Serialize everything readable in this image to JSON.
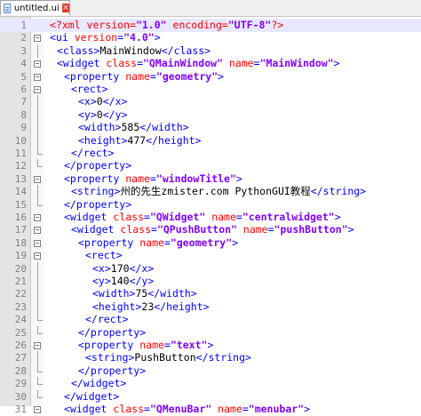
{
  "tab": {
    "label": "untitled.ui",
    "close": "×"
  },
  "colors": {
    "tag": "#0000ff",
    "attr": "#ff0000",
    "value": "#8000ff",
    "text": "#000000",
    "gutter": "#e4e4e4",
    "current_line": "#e8e8ff"
  },
  "lines": [
    {
      "n": "1",
      "indent": 0,
      "fold": "",
      "parts": [
        [
          "pi",
          "<?xml "
        ],
        [
          "attr",
          "version"
        ],
        [
          "pi",
          "="
        ],
        [
          "val",
          "\"1.0\""
        ],
        [
          "pi",
          " "
        ],
        [
          "attr",
          "encoding"
        ],
        [
          "pi",
          "="
        ],
        [
          "val",
          "\"UTF-8\""
        ],
        [
          "pi",
          "?>"
        ]
      ]
    },
    {
      "n": "2",
      "indent": 0,
      "fold": "minus",
      "parts": [
        [
          "tag",
          "<ui "
        ],
        [
          "attr",
          "version"
        ],
        [
          "tag",
          "="
        ],
        [
          "val",
          "\"4.0\""
        ],
        [
          "tag",
          ">"
        ]
      ]
    },
    {
      "n": "3",
      "indent": 1,
      "fold": "",
      "parts": [
        [
          "tag",
          "<class>"
        ],
        [
          "txt",
          "MainWindow"
        ],
        [
          "tag",
          "</class>"
        ]
      ]
    },
    {
      "n": "4",
      "indent": 1,
      "fold": "minus",
      "parts": [
        [
          "tag",
          "<widget "
        ],
        [
          "attr",
          "class"
        ],
        [
          "tag",
          "="
        ],
        [
          "val",
          "\"QMainWindow\""
        ],
        [
          "tag",
          " "
        ],
        [
          "attr",
          "name"
        ],
        [
          "tag",
          "="
        ],
        [
          "val",
          "\"MainWindow\""
        ],
        [
          "tag",
          ">"
        ]
      ]
    },
    {
      "n": "5",
      "indent": 2,
      "fold": "minus",
      "parts": [
        [
          "tag",
          "<property "
        ],
        [
          "attr",
          "name"
        ],
        [
          "tag",
          "="
        ],
        [
          "val",
          "\"geometry\""
        ],
        [
          "tag",
          ">"
        ]
      ]
    },
    {
      "n": "6",
      "indent": 3,
      "fold": "minus",
      "parts": [
        [
          "tag",
          "<rect>"
        ]
      ]
    },
    {
      "n": "7",
      "indent": 4,
      "fold": "",
      "parts": [
        [
          "tag",
          "<x>"
        ],
        [
          "txt",
          "0"
        ],
        [
          "tag",
          "</x>"
        ]
      ]
    },
    {
      "n": "8",
      "indent": 4,
      "fold": "",
      "parts": [
        [
          "tag",
          "<y>"
        ],
        [
          "txt",
          "0"
        ],
        [
          "tag",
          "</y>"
        ]
      ]
    },
    {
      "n": "9",
      "indent": 4,
      "fold": "",
      "parts": [
        [
          "tag",
          "<width>"
        ],
        [
          "txt",
          "585"
        ],
        [
          "tag",
          "</width>"
        ]
      ]
    },
    {
      "n": "10",
      "indent": 4,
      "fold": "",
      "parts": [
        [
          "tag",
          "<height>"
        ],
        [
          "txt",
          "477"
        ],
        [
          "tag",
          "</height>"
        ]
      ]
    },
    {
      "n": "11",
      "indent": 3,
      "fold": "end",
      "parts": [
        [
          "tag",
          "</rect>"
        ]
      ]
    },
    {
      "n": "12",
      "indent": 2,
      "fold": "end",
      "parts": [
        [
          "tag",
          "</property>"
        ]
      ]
    },
    {
      "n": "13",
      "indent": 2,
      "fold": "minus",
      "parts": [
        [
          "tag",
          "<property "
        ],
        [
          "attr",
          "name"
        ],
        [
          "tag",
          "="
        ],
        [
          "val",
          "\"windowTitle\""
        ],
        [
          "tag",
          ">"
        ]
      ]
    },
    {
      "n": "14",
      "indent": 3,
      "fold": "",
      "parts": [
        [
          "tag",
          "<string>"
        ],
        [
          "txt",
          "州的先生zmister.com PythonGUI教程"
        ],
        [
          "tag",
          "</string>"
        ]
      ]
    },
    {
      "n": "15",
      "indent": 2,
      "fold": "end",
      "parts": [
        [
          "tag",
          "</property>"
        ]
      ]
    },
    {
      "n": "16",
      "indent": 2,
      "fold": "minus",
      "parts": [
        [
          "tag",
          "<widget "
        ],
        [
          "attr",
          "class"
        ],
        [
          "tag",
          "="
        ],
        [
          "val",
          "\"QWidget\""
        ],
        [
          "tag",
          " "
        ],
        [
          "attr",
          "name"
        ],
        [
          "tag",
          "="
        ],
        [
          "val",
          "\"centralwidget\""
        ],
        [
          "tag",
          ">"
        ]
      ]
    },
    {
      "n": "17",
      "indent": 3,
      "fold": "minus",
      "parts": [
        [
          "tag",
          "<widget "
        ],
        [
          "attr",
          "class"
        ],
        [
          "tag",
          "="
        ],
        [
          "val",
          "\"QPushButton\""
        ],
        [
          "tag",
          " "
        ],
        [
          "attr",
          "name"
        ],
        [
          "tag",
          "="
        ],
        [
          "val",
          "\"pushButton\""
        ],
        [
          "tag",
          ">"
        ]
      ]
    },
    {
      "n": "18",
      "indent": 4,
      "fold": "minus",
      "parts": [
        [
          "tag",
          "<property "
        ],
        [
          "attr",
          "name"
        ],
        [
          "tag",
          "="
        ],
        [
          "val",
          "\"geometry\""
        ],
        [
          "tag",
          ">"
        ]
      ]
    },
    {
      "n": "19",
      "indent": 5,
      "fold": "minus",
      "parts": [
        [
          "tag",
          "<rect>"
        ]
      ]
    },
    {
      "n": "20",
      "indent": 6,
      "fold": "",
      "parts": [
        [
          "tag",
          "<x>"
        ],
        [
          "txt",
          "170"
        ],
        [
          "tag",
          "</x>"
        ]
      ]
    },
    {
      "n": "21",
      "indent": 6,
      "fold": "",
      "parts": [
        [
          "tag",
          "<y>"
        ],
        [
          "txt",
          "140"
        ],
        [
          "tag",
          "</y>"
        ]
      ]
    },
    {
      "n": "22",
      "indent": 6,
      "fold": "",
      "parts": [
        [
          "tag",
          "<width>"
        ],
        [
          "txt",
          "75"
        ],
        [
          "tag",
          "</width>"
        ]
      ]
    },
    {
      "n": "23",
      "indent": 6,
      "fold": "",
      "parts": [
        [
          "tag",
          "<height>"
        ],
        [
          "txt",
          "23"
        ],
        [
          "tag",
          "</height>"
        ]
      ]
    },
    {
      "n": "24",
      "indent": 5,
      "fold": "end",
      "parts": [
        [
          "tag",
          "</rect>"
        ]
      ]
    },
    {
      "n": "25",
      "indent": 4,
      "fold": "end",
      "parts": [
        [
          "tag",
          "</property>"
        ]
      ]
    },
    {
      "n": "26",
      "indent": 4,
      "fold": "minus",
      "parts": [
        [
          "tag",
          "<property "
        ],
        [
          "attr",
          "name"
        ],
        [
          "tag",
          "="
        ],
        [
          "val",
          "\"text\""
        ],
        [
          "tag",
          ">"
        ]
      ]
    },
    {
      "n": "27",
      "indent": 5,
      "fold": "",
      "parts": [
        [
          "tag",
          "<string>"
        ],
        [
          "txt",
          "PushButton"
        ],
        [
          "tag",
          "</string>"
        ]
      ]
    },
    {
      "n": "28",
      "indent": 4,
      "fold": "end",
      "parts": [
        [
          "tag",
          "</property>"
        ]
      ]
    },
    {
      "n": "29",
      "indent": 3,
      "fold": "end",
      "parts": [
        [
          "tag",
          "</widget>"
        ]
      ]
    },
    {
      "n": "30",
      "indent": 2,
      "fold": "end",
      "parts": [
        [
          "tag",
          "</widget>"
        ]
      ]
    },
    {
      "n": "31",
      "indent": 2,
      "fold": "minus",
      "parts": [
        [
          "tag",
          "<widget "
        ],
        [
          "attr",
          "class"
        ],
        [
          "tag",
          "="
        ],
        [
          "val",
          "\"QMenuBar\""
        ],
        [
          "tag",
          " "
        ],
        [
          "attr",
          "name"
        ],
        [
          "tag",
          "="
        ],
        [
          "val",
          "\"menubar\""
        ],
        [
          "tag",
          ">"
        ]
      ]
    }
  ]
}
